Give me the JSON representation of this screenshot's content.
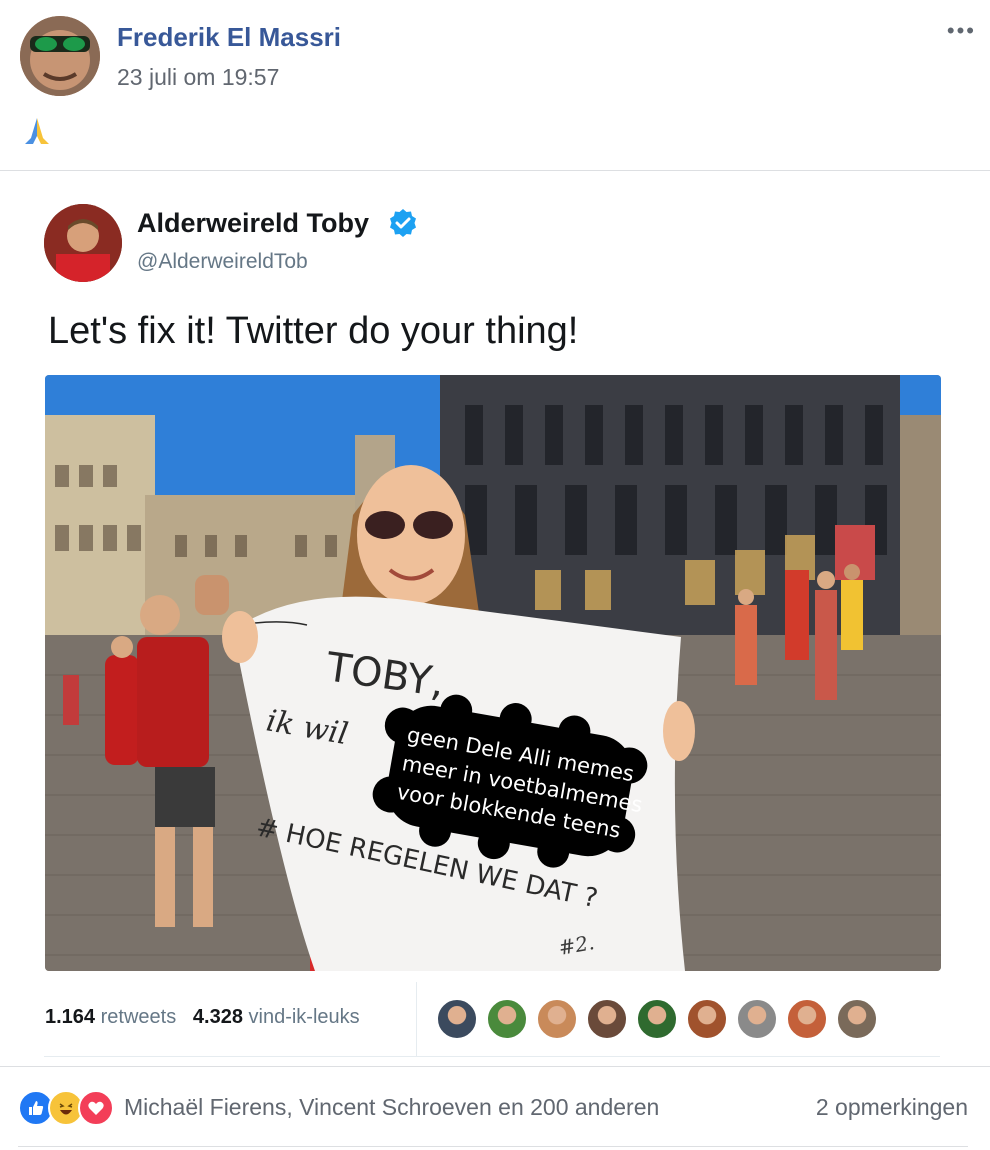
{
  "post": {
    "author": "Frederik El Massri",
    "timestamp": "23 juli om 19:57",
    "more_label": "•••",
    "emoji_icon": "folded-hands-emoji"
  },
  "tweet": {
    "name": "Alderweireld Toby",
    "handle": "@AlderweireldTob",
    "text": "Let's fix it! Twitter do your thing!",
    "photo": {
      "sign_line1": "TOBY,",
      "sign_line2": "ik wil",
      "sign_overlay": [
        "geen Dele Alli memes",
        "meer in voetbalmemes",
        "voor blokkende teens"
      ],
      "sign_line3": "# HOE REGELEN WE DAT ?",
      "sign_corner": "#2."
    },
    "retweets_count": "1.164",
    "retweets_label": "retweets",
    "likes_count": "4.328",
    "likes_label": "vind-ik-leuks",
    "liker_colors": [
      "#3b4a5e",
      "#4a8a3c",
      "#c98a5a",
      "#6a4a3a",
      "#2f6a2f",
      "#a0522d",
      "#8a8a8a",
      "#c4603a",
      "#7a6a5a"
    ]
  },
  "footer": {
    "reactions_text": "Michaël Fierens, Vincent Schroeven en 200 anderen",
    "comments_text": "2 opmerkingen",
    "colors": {
      "like": "#2078f4",
      "haha": "#f7c33a",
      "love": "#f33e58"
    }
  }
}
